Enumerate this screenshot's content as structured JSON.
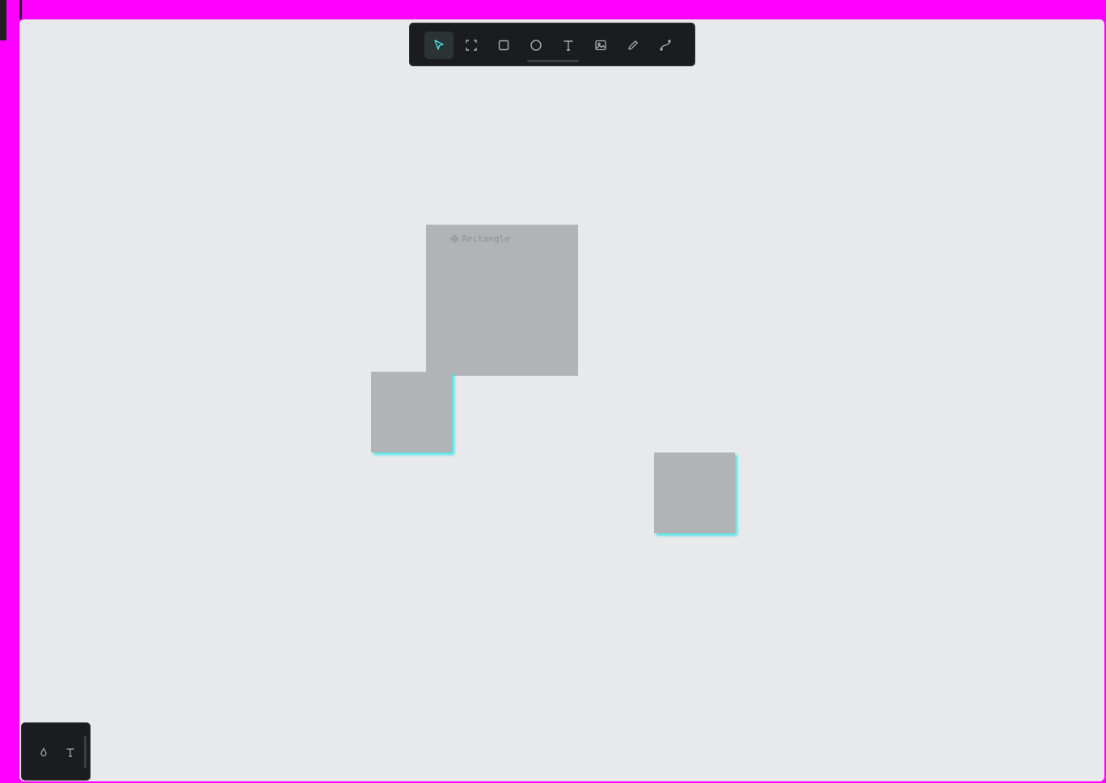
{
  "toolbar": {
    "tools": [
      {
        "id": "select",
        "icon": "pointer-icon",
        "active": true
      },
      {
        "id": "frame",
        "icon": "frame-icon",
        "active": false
      },
      {
        "id": "rectangle",
        "icon": "rectangle-icon",
        "active": false
      },
      {
        "id": "ellipse",
        "icon": "ellipse-icon",
        "active": false
      },
      {
        "id": "text",
        "icon": "text-icon",
        "active": false
      },
      {
        "id": "image",
        "icon": "image-icon",
        "active": false
      },
      {
        "id": "pencil",
        "icon": "pencil-icon",
        "active": false
      },
      {
        "id": "path",
        "icon": "path-icon",
        "active": false
      }
    ]
  },
  "canvas": {
    "shapes": [
      {
        "name": "Rectangle",
        "show_label": true
      },
      {
        "name": "",
        "show_label": false
      },
      {
        "name": "",
        "show_label": false
      }
    ]
  },
  "bottom_panel": {
    "buttons": [
      {
        "id": "fill",
        "icon": "droplet-icon"
      },
      {
        "id": "typography",
        "icon": "text-icon"
      }
    ]
  },
  "colors": {
    "accent": "#40e2e6",
    "toolbar_bg": "#1b1c1e",
    "canvas_bg": "#e8e9eb",
    "shape_fill": "#b2b3b6",
    "frame_bg": "#ff00ff"
  }
}
